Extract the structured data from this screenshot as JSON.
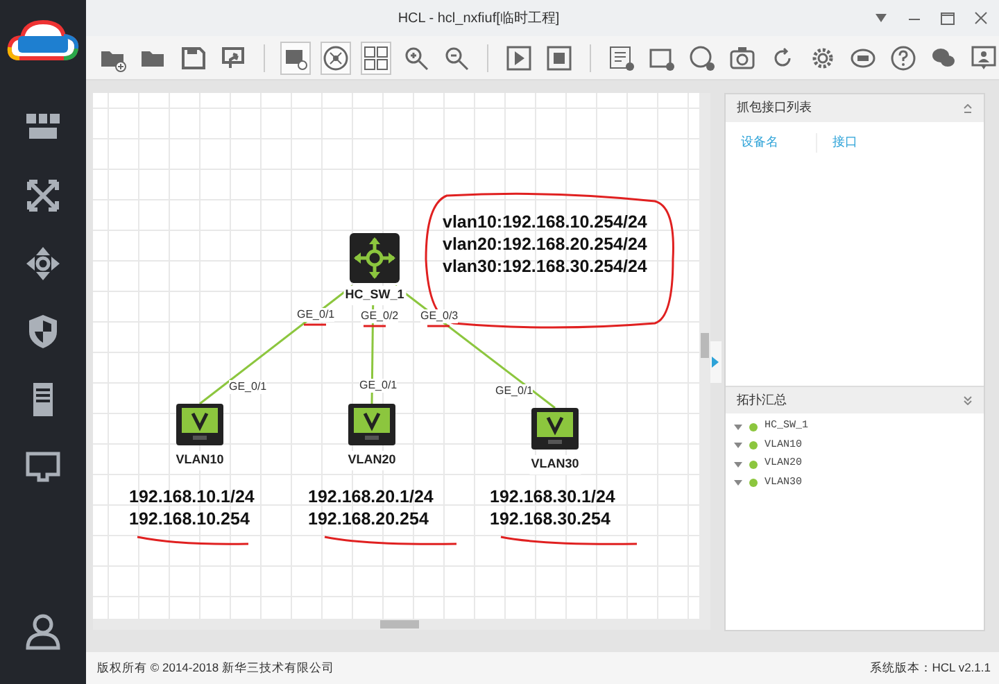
{
  "window": {
    "title": "HCL - hcl_nxfiuf[临时工程]"
  },
  "canvas": {
    "devices": [
      {
        "name": "HC_SW_1",
        "kind": "switch"
      },
      {
        "name": "VLAN10",
        "kind": "pc"
      },
      {
        "name": "VLAN20",
        "kind": "pc"
      },
      {
        "name": "VLAN30",
        "kind": "pc"
      }
    ],
    "links": [
      {
        "switch_port": "GE_0/1",
        "pc_port": "GE_0/1"
      },
      {
        "switch_port": "GE_0/2",
        "pc_port": "GE_0/1"
      },
      {
        "switch_port": "GE_0/3",
        "pc_port": "GE_0/1"
      }
    ],
    "switch_note": [
      "vlan10:192.168.10.254/24",
      "vlan20:192.168.20.254/24",
      "vlan30:192.168.30.254/24"
    ],
    "pc_notes": [
      [
        "192.168.10.1/24",
        "192.168.10.254"
      ],
      [
        "192.168.20.1/24",
        "192.168.20.254"
      ],
      [
        "192.168.30.1/24",
        "192.168.30.254"
      ]
    ]
  },
  "capture_panel": {
    "title": "抓包接口列表",
    "columns": [
      "设备名",
      "接口"
    ]
  },
  "topology_panel": {
    "title": "拓扑汇总",
    "items": [
      {
        "name": "HC_SW_1",
        "color": "#8cc63e"
      },
      {
        "name": "VLAN10",
        "color": "#8cc63e"
      },
      {
        "name": "VLAN20",
        "color": "#8cc63e"
      },
      {
        "name": "VLAN30",
        "color": "#8cc63e"
      }
    ]
  },
  "status_bar": {
    "copyright": "版权所有 © 2014-2018 新华三技术有限公司",
    "version": "系统版本：HCL v2.1.1"
  }
}
